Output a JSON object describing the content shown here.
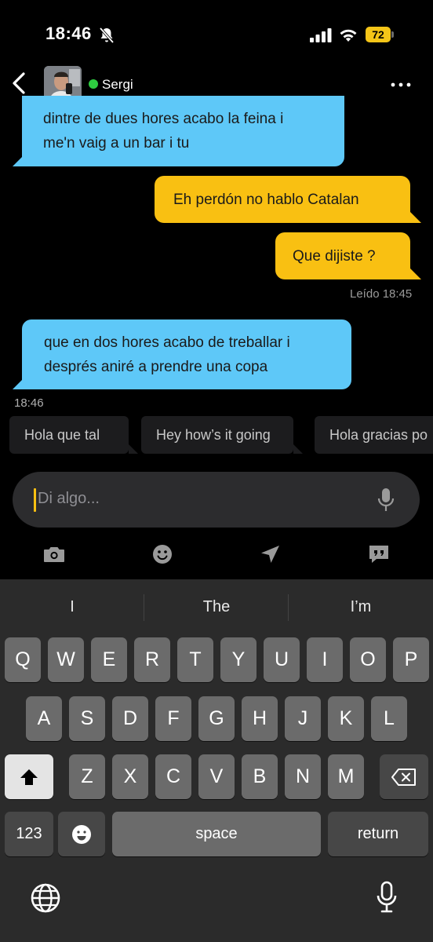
{
  "status_bar": {
    "time": "18:46",
    "battery": "72"
  },
  "header": {
    "contact_name": "Sergi"
  },
  "messages": [
    {
      "direction": "incoming",
      "lines": [
        "dintre de dues hores acabo la feina i",
        "me'n vaig a un bar i tu"
      ]
    },
    {
      "direction": "outgoing",
      "lines": [
        "Eh perdón no hablo Catalan"
      ]
    },
    {
      "direction": "outgoing",
      "lines": [
        "Que dijiste ?"
      ]
    },
    {
      "direction": "incoming",
      "lines": [
        "que en dos hores acabo de treballar i",
        "després aniré a prendre una copa"
      ]
    }
  ],
  "read_receipt": "Leído 18:45",
  "last_time": "18:46",
  "quick_replies": [
    "Hola que tal",
    "Hey how’s it going",
    "Hola gracias po"
  ],
  "input": {
    "placeholder": "Di algo..."
  },
  "keyboard": {
    "suggestions": [
      "I",
      "The",
      "I’m"
    ],
    "row1": [
      "Q",
      "W",
      "E",
      "R",
      "T",
      "Y",
      "U",
      "I",
      "O",
      "P"
    ],
    "row2": [
      "A",
      "S",
      "D",
      "F",
      "G",
      "H",
      "J",
      "K",
      "L"
    ],
    "row3": [
      "Z",
      "X",
      "C",
      "V",
      "B",
      "N",
      "M"
    ],
    "numbers_label": "123",
    "space_label": "space",
    "return_label": "return"
  },
  "colors": {
    "incoming_bubble": "#5ec8f8",
    "outgoing_bubble": "#f9c012",
    "online": "#2ecc40"
  },
  "icons": [
    "bell-off-icon",
    "signal-icon",
    "wifi-icon",
    "back-chevron-icon",
    "more-dots-icon",
    "mic-icon",
    "camera-icon",
    "emoji-icon",
    "location-arrow-icon",
    "quote-bubble-icon",
    "shift-icon",
    "delete-icon",
    "globe-icon",
    "dictation-mic-icon"
  ]
}
